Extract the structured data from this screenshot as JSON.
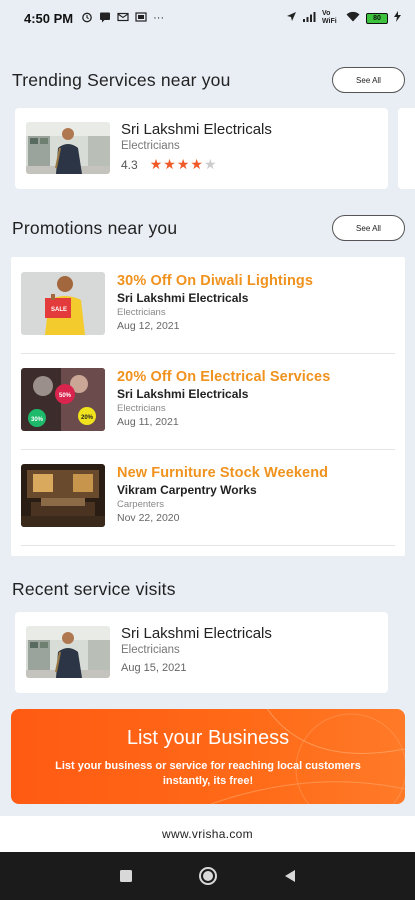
{
  "status_bar": {
    "time": "4:50 PM",
    "icons": [
      "alarm-icon",
      "message-icon",
      "mail-icon",
      "screen-icon",
      "more-icon"
    ],
    "right_icons": [
      "location-icon",
      "signal-icon",
      "vowifi-icon",
      "wifi-icon",
      "battery-icon"
    ],
    "vowifi": "Vo WiFi",
    "battery_level": "80",
    "more": "···"
  },
  "trending": {
    "title": "Trending Services near you",
    "see_all": "See All",
    "items": [
      {
        "name": "Sri Lakshmi Electricals",
        "category": "Electricians",
        "rating": "4.3",
        "stars": 4
      }
    ]
  },
  "promotions": {
    "title": "Promotions near you",
    "see_all": "See All",
    "items": [
      {
        "title": "30% Off On Diwali Lightings",
        "business": "Sri Lakshmi Electricals",
        "category": "Electricians",
        "date": "Aug 12, 2021",
        "thumb_badge": "SALE"
      },
      {
        "title": "20% Off On Electrical Services",
        "business": "Sri Lakshmi Electricals",
        "category": "Electricians",
        "date": "Aug 11, 2021",
        "badges": [
          "50%",
          "30%",
          "20%"
        ]
      },
      {
        "title": "New Furniture Stock Weekend",
        "business": "Vikram Carpentry Works",
        "category": "Carpenters",
        "date": "Nov 22, 2020"
      }
    ]
  },
  "recent": {
    "title": "Recent service visits",
    "items": [
      {
        "name": "Sri Lakshmi Electricals",
        "category": "Electricians",
        "date": "Aug 15, 2021"
      }
    ]
  },
  "banner": {
    "title": "List your Business",
    "subtitle": "List your business or service for reaching local customers instantly, its free!"
  },
  "footer": {
    "website": "www.vrisha.com"
  },
  "colors": {
    "accent": "#f05a28",
    "promo_title": "#f0921e",
    "banner": "#ff5a13"
  }
}
